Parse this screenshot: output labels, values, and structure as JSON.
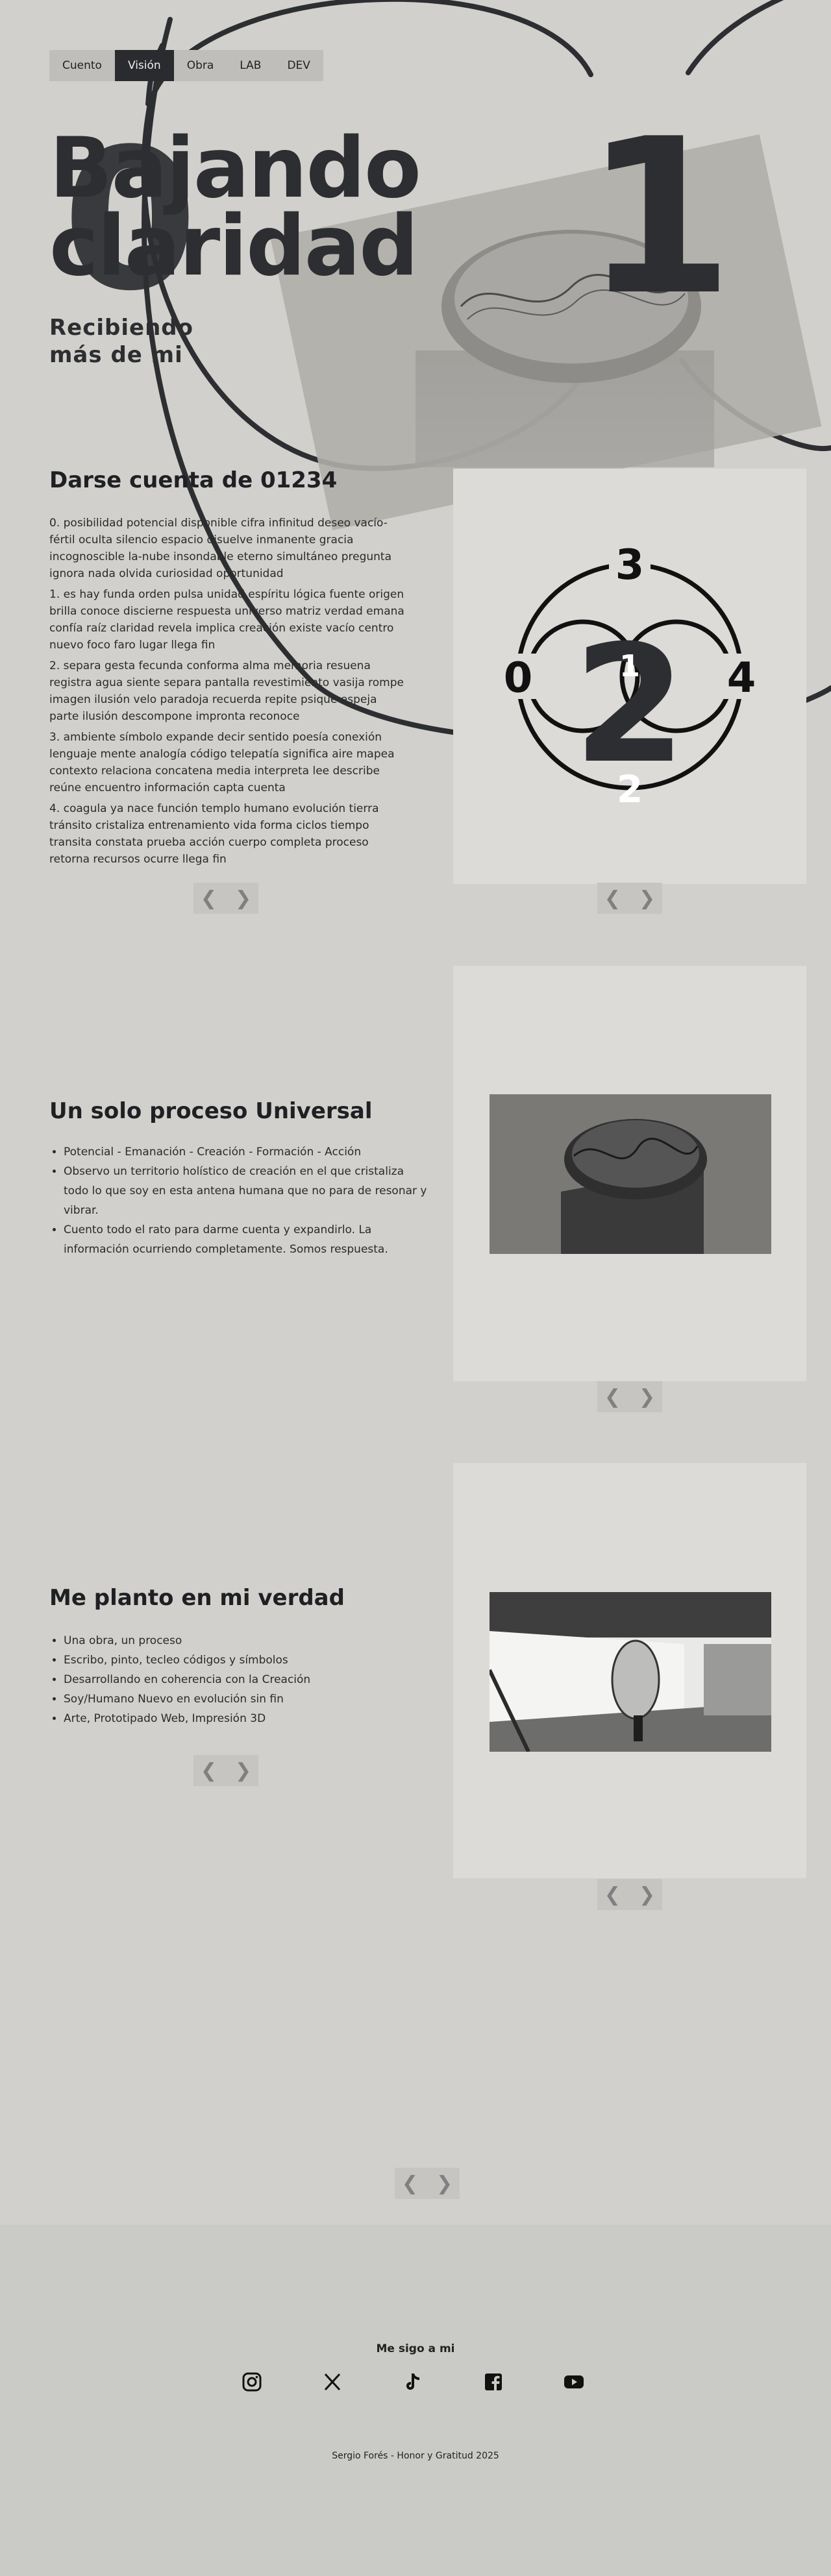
{
  "nav": {
    "items": [
      "Cuento",
      "Visión",
      "Obra",
      "LAB",
      "DEV"
    ],
    "active": "Visión"
  },
  "hero": {
    "title_line1": "Bajando",
    "title_line2": "claridad",
    "subtitle_line1": "Recibiendo",
    "subtitle_line2": "más de mi",
    "big_left": "0",
    "big_right": "1"
  },
  "section1": {
    "title": "Darse cuenta de 01234",
    "paragraphs": [
      "0. posibilidad potencial disponible cifra infinitud deseo vacío-fértil oculta silencio espacio disuelve inmanente gracia incognoscible la-nube insondable eterno simultáneo pregunta ignora nada olvida curiosidad oportunidad",
      "1. es hay funda orden pulsa unidad espíritu lógica fuente origen brilla conoce discierne respuesta universo matriz verdad emana confía raíz claridad revela implica creación existe vacío centro nuevo foco faro lugar llega fin",
      "2. separa gesta fecunda conforma alma memoria resuena registra agua siente separa pantalla revestimiento vasija rompe imagen ilusión velo paradoja recuerda repite psique espeja parte ilusión descompone impronta reconoce",
      "3. ambiente símbolo expande decir sentido poesía conexión lenguaje mente analogía código telepatía significa aire mapea contexto relaciona concatena media interpreta lee describe reúne encuentro información capta cuenta",
      "4. coagula ya nace función templo humano evolución tierra tránsito cristaliza entrenamiento vida forma ciclos tiempo transita constata prueba acción cuerpo completa proceso retorna recursos ocurre llega fin"
    ],
    "diagram_numbers": [
      "3",
      "0",
      "1",
      "4",
      "2",
      "2"
    ]
  },
  "section2": {
    "title": "Un solo proceso Universal",
    "bullets": [
      "Potencial - Emanación - Creación - Formación - Acción",
      "Observo un territorio holístico de creación en el que cristaliza todo lo que soy en esta antena humana que no para de resonar y vibrar.",
      "Cuento todo el rato para darme cuenta y expandirlo. La información ocurriendo completamente. Somos respuesta."
    ]
  },
  "section3": {
    "title": "Me planto en mi verdad",
    "bullets": [
      "Una obra, un proceso",
      "Escribo, pinto, tecleo códigos y símbolos",
      "Desarrollando en coherencia con la Creación",
      "Soy/Humano Nuevo en evolución sin fin",
      "Arte, Prototipado Web, Impresión 3D"
    ]
  },
  "pager": {
    "prev": "❮",
    "next": "❯"
  },
  "footer": {
    "follow_label": "Me sigo a mi",
    "socials": [
      "instagram-icon",
      "x-icon",
      "tiktok-icon",
      "facebook-icon",
      "youtube-icon"
    ],
    "credit": "Sergio Forés - Honor y Gratitud 2025"
  },
  "colors": {
    "background": "#d1d0cc",
    "dark": "#2d2e31",
    "card": "#dcdbd8",
    "pager": "#c6c5c2",
    "footer": "#cacac6"
  }
}
